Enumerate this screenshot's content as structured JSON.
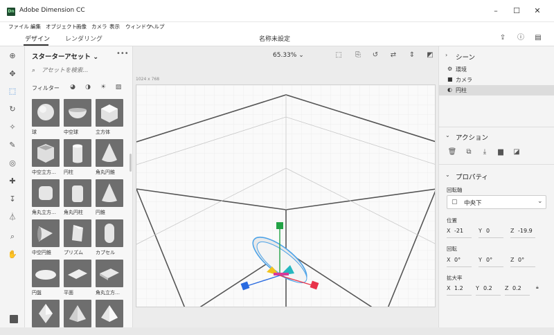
{
  "window": {
    "app_icon": "Dn",
    "title": "Adobe Dimension CC",
    "minimize": "–",
    "maximize": "☐",
    "close": "✕"
  },
  "menu": [
    "ファイル",
    "編集",
    "オブジェクト",
    "画像",
    "カメラ",
    "表示",
    "ウィンドウ",
    "ヘルプ"
  ],
  "tabs": {
    "design": "デザイン",
    "render": "レンダリング"
  },
  "document_title": "名称未設定",
  "assets": {
    "title": "スターターアセット",
    "more": "•••",
    "search_placeholder": "アセットを検索...",
    "filter_label": "フィルター",
    "items": [
      {
        "label": "球",
        "shape": "sphere"
      },
      {
        "label": "中空球",
        "shape": "hollow-sphere"
      },
      {
        "label": "立方体",
        "shape": "cube"
      },
      {
        "label": "中空立方…",
        "shape": "hollow-cube"
      },
      {
        "label": "円柱",
        "shape": "cylinder"
      },
      {
        "label": "角丸円錐",
        "shape": "rounded-cone"
      },
      {
        "label": "角丸立方…",
        "shape": "rounded-cube"
      },
      {
        "label": "角丸円柱",
        "shape": "rounded-cylinder"
      },
      {
        "label": "円錐",
        "shape": "cone"
      },
      {
        "label": "中空円錐",
        "shape": "hollow-cone"
      },
      {
        "label": "プリズム",
        "shape": "prism"
      },
      {
        "label": "カプセル",
        "shape": "capsule"
      },
      {
        "label": "円盤",
        "shape": "disc"
      },
      {
        "label": "平面",
        "shape": "plane"
      },
      {
        "label": "角丸立方…",
        "shape": "rounded-slab"
      },
      {
        "label": "",
        "shape": "octahedron"
      },
      {
        "label": "",
        "shape": "pyramid"
      },
      {
        "label": "",
        "shape": "pyramid2"
      }
    ]
  },
  "viewport": {
    "zoom": "65.33%",
    "canvas_size": "1024 x 768"
  },
  "scene": {
    "title": "シーン",
    "items": [
      {
        "icon": "environment-icon",
        "glyph": "⚙",
        "label": "環境"
      },
      {
        "icon": "camera-icon",
        "glyph": "■",
        "label": "カメラ"
      },
      {
        "icon": "model-icon",
        "glyph": "◐",
        "label": "円柱"
      }
    ]
  },
  "actions": {
    "title": "アクション"
  },
  "properties": {
    "title": "プロパティ",
    "pivot_label": "回転軸",
    "pivot_value": "中央下",
    "position_label": "位置",
    "position": {
      "x": "-21",
      "y": "0",
      "z": "-19.9"
    },
    "rotation_label": "回転",
    "rotation": {
      "x": "0°",
      "y": "0°",
      "z": "0°"
    },
    "scale_label": "拡大率",
    "scale": {
      "x": "1.2",
      "y": "0.2",
      "z": "0.2"
    }
  },
  "colors": {
    "accent": "#2a7bd4",
    "gizmo_x": "#e8334a",
    "gizmo_y": "#22a245",
    "gizmo_z": "#2a6be0",
    "selection": "#4da3e8"
  }
}
